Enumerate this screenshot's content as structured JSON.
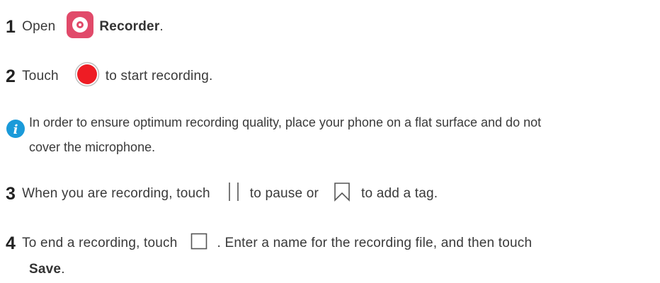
{
  "step1": {
    "number": "1",
    "before": "Open",
    "app_name": "Recorder",
    "after": ".",
    "icon": "recorder-app-icon"
  },
  "step2": {
    "number": "2",
    "before": "Touch",
    "after": "to start recording.",
    "icon": "record-button-icon"
  },
  "note": {
    "icon": "info-icon",
    "line1": "In order to ensure optimum recording quality, place your phone on a flat surface and do not",
    "line2": "cover the microphone."
  },
  "step3": {
    "number": "3",
    "before": "When you are recording, touch",
    "middle": "to pause or",
    "after": "to add a tag.",
    "icons": [
      "pause-icon",
      "bookmark-tag-icon"
    ]
  },
  "step4": {
    "number": "4",
    "before": "To end a recording, touch",
    "after": ". Enter a name for the recording file, and then touch",
    "save_label": "Save",
    "save_after": ".",
    "icon": "stop-icon"
  },
  "colors": {
    "recorder_icon_bg": "#e14a6a",
    "record_red": "#ee1c24",
    "info_blue": "#1a9ad9",
    "text": "#3a3a3a"
  }
}
